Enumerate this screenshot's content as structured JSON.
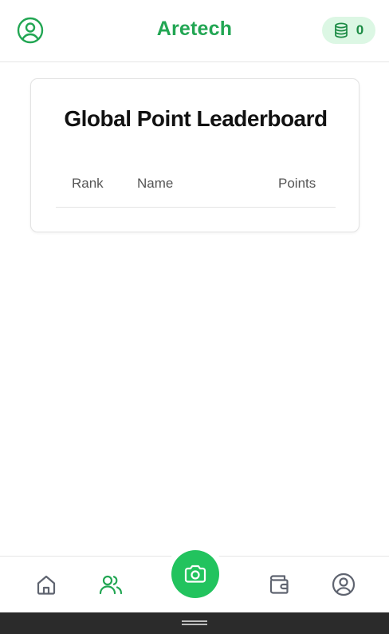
{
  "header": {
    "title": "Aretech",
    "coin_count": "0",
    "profile_icon": "user-circle-icon",
    "coin_icon": "coins-stack-icon"
  },
  "leaderboard": {
    "title": "Global Point Leaderboard",
    "columns": [
      "Rank",
      "Name",
      "Points"
    ],
    "rows": []
  },
  "bottom_nav": {
    "items": [
      {
        "icon": "home-icon",
        "active": false
      },
      {
        "icon": "users-icon",
        "active": true
      },
      {
        "icon": "camera-icon",
        "active": false
      },
      {
        "icon": "wallet-icon",
        "active": false
      },
      {
        "icon": "user-circle-icon",
        "active": false
      }
    ]
  },
  "colors": {
    "brand": "#22a653",
    "camera_button": "#22c35e",
    "coin_badge_bg": "#dcf7e4",
    "inactive_icon": "#5f6470"
  }
}
